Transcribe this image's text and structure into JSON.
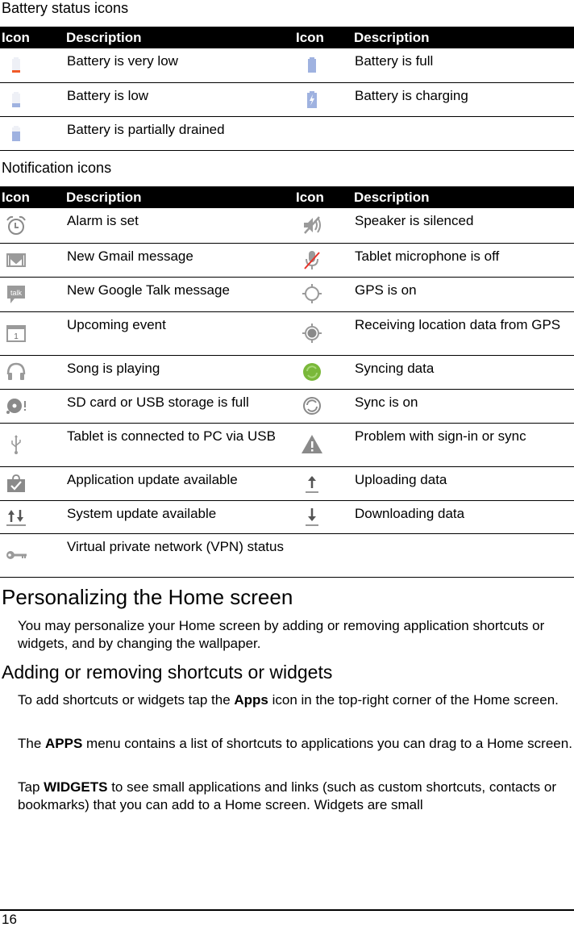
{
  "battery_section": {
    "title": "Battery status icons",
    "headers": [
      "Icon",
      "Description",
      "Icon",
      "Description"
    ],
    "rows": [
      {
        "left_icon": "battery-very-low-icon",
        "left_desc": "Battery is very low",
        "right_icon": "battery-full-icon",
        "right_desc": "Battery is full"
      },
      {
        "left_icon": "battery-low-icon",
        "left_desc": "Battery is low",
        "right_icon": "battery-charging-icon",
        "right_desc": "Battery is charging"
      },
      {
        "left_icon": "battery-partially-drained-icon",
        "left_desc": "Battery is partially drained",
        "right_icon": "",
        "right_desc": ""
      }
    ]
  },
  "notification_section": {
    "title": "Notification icons",
    "headers": [
      "Icon",
      "Description",
      "Icon",
      "Description"
    ],
    "rows": [
      {
        "left_icon": "alarm-icon",
        "left_desc": "Alarm is set",
        "right_icon": "speaker-muted-icon",
        "right_desc": "Speaker is silenced"
      },
      {
        "left_icon": "gmail-icon",
        "left_desc": "New Gmail message",
        "right_icon": "microphone-off-icon",
        "right_desc": "Tablet microphone is off"
      },
      {
        "left_icon": "talk-icon",
        "left_desc": "New Google Talk message",
        "right_icon": "gps-on-icon",
        "right_desc": "GPS is on"
      },
      {
        "left_icon": "calendar-event-icon",
        "left_desc": "Upcoming event",
        "right_icon": "gps-receiving-icon",
        "right_desc": "Receiving location data from GPS"
      },
      {
        "left_icon": "headphones-icon",
        "left_desc": "Song is playing",
        "right_icon": "syncing-icon",
        "right_desc": "Syncing data"
      },
      {
        "left_icon": "storage-full-icon",
        "left_desc": "SD card or USB storage is full",
        "right_icon": "sync-on-icon",
        "right_desc": "Sync is on"
      },
      {
        "left_icon": "usb-icon",
        "left_desc": "Tablet is connected to PC via USB",
        "right_icon": "warning-icon",
        "right_desc": "Problem with sign-in or sync"
      },
      {
        "left_icon": "app-update-icon",
        "left_desc": "Application update available",
        "right_icon": "upload-icon",
        "right_desc": "Uploading data"
      },
      {
        "left_icon": "system-update-icon",
        "left_desc": "System update available",
        "right_icon": "download-icon",
        "right_desc": "Downloading data"
      },
      {
        "left_icon": "vpn-key-icon",
        "left_desc": "Virtual private network (VPN) status",
        "right_icon": "",
        "right_desc": ""
      }
    ]
  },
  "personalize": {
    "heading": "Personalizing the Home screen",
    "intro": "You may personalize your Home screen by adding or removing application shortcuts or widgets, and by changing the wallpaper."
  },
  "shortcuts": {
    "heading": "Adding or removing shortcuts or widgets",
    "p1": {
      "before": "To add shortcuts or widgets tap the ",
      "bold": "Apps",
      "after": " icon in the top-right corner of the Home screen."
    },
    "p2": {
      "before": "The ",
      "bold": "APPS",
      "after": " menu contains a list of shortcuts to applications you can drag to a Home screen."
    },
    "p3": {
      "before": "Tap ",
      "bold": "WIDGETS",
      "after": " to see small applications and links (such as custom shortcuts, contacts or bookmarks) that you can add to a Home screen. Widgets are small"
    }
  },
  "footer": {
    "page_number": "16"
  },
  "colors": {
    "battery_blue": "#9fb2e0",
    "battery_red": "#f05a28",
    "icon_gray": "#8a8a8a",
    "sync_green": "#7ab83a"
  }
}
